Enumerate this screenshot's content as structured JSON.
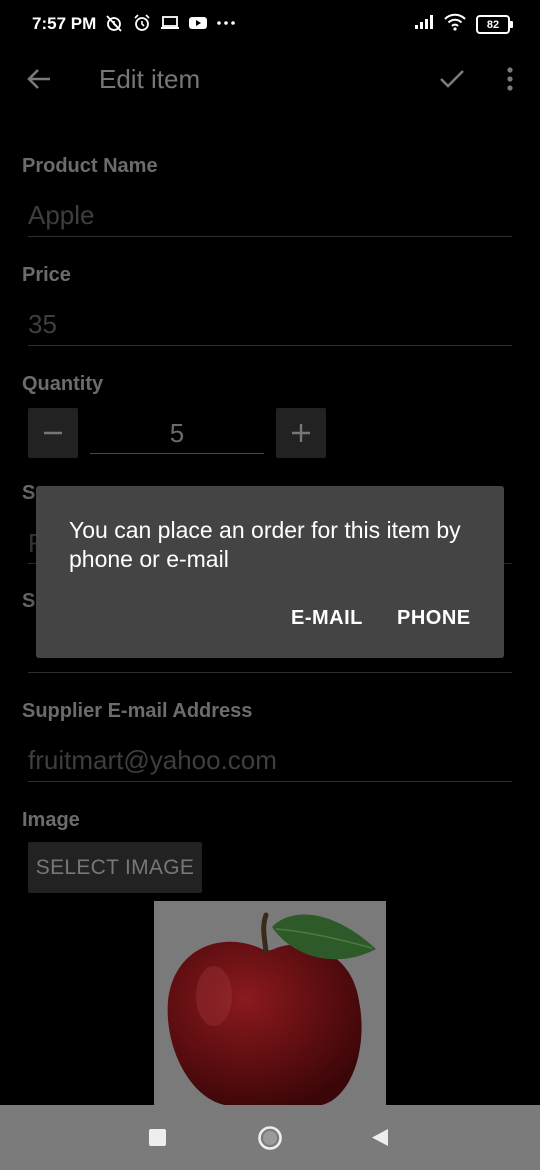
{
  "status_bar": {
    "time": "7:57 PM",
    "battery": "82",
    "icons": [
      "alarm-off-icon",
      "alarm-icon",
      "laptop-icon",
      "youtube-icon",
      "more-dots-icon",
      "signal-icon",
      "wifi-icon",
      "battery-icon"
    ]
  },
  "app_bar": {
    "title": "Edit item",
    "icons": [
      "back-arrow-icon",
      "check-icon",
      "overflow-menu-icon"
    ]
  },
  "form": {
    "product_name_label": "Product Name",
    "product_name_value": "Apple",
    "price_label": "Price",
    "price_value": "35",
    "quantity_label": "Quantity",
    "quantity_value": "5",
    "supplier_name_label_partial": "S",
    "supplier_name_value_partial": "F",
    "supplier_phone_label_partial": "S",
    "supplier_email_label": "Supplier E-mail Address",
    "supplier_email_value": "fruitmart@yahoo.com",
    "image_label": "Image",
    "select_image_button": "SELECT IMAGE"
  },
  "dialog": {
    "message": "You can place an order for this item by phone or e-mail",
    "email_button": "E-MAIL",
    "phone_button": "PHONE"
  },
  "nav_bar": {
    "icons": [
      "recents-square-icon",
      "home-circle-icon",
      "back-triangle-icon"
    ]
  },
  "colors": {
    "background": "#000000",
    "dialog": "#444444",
    "nav_bar": "#7b7b7b"
  }
}
